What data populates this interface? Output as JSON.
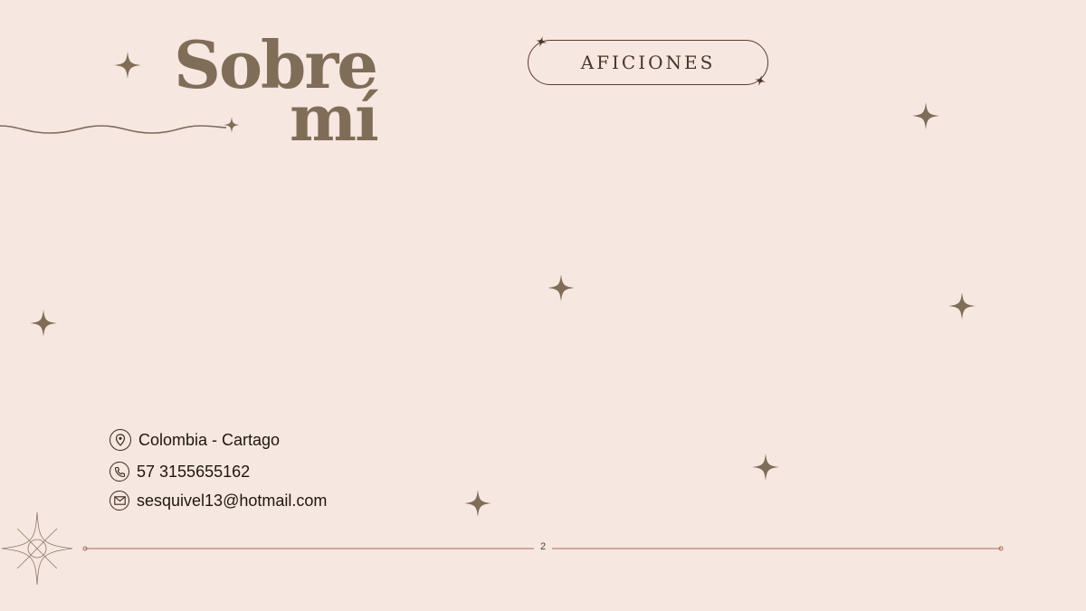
{
  "title": {
    "line1": "Sobre",
    "line2": "mí"
  },
  "section_pill": {
    "label": "AFICIONES"
  },
  "contacts": [
    {
      "icon": "location-pin-icon",
      "text": "Colombia - Cartago"
    },
    {
      "icon": "phone-icon",
      "text": "57 3155655162"
    },
    {
      "icon": "mail-icon",
      "text": "sesquivel13@hotmail.com"
    }
  ],
  "footer": {
    "page_number": "2"
  },
  "colors": {
    "background": "#f7e7e1",
    "accent": "#7f6d58",
    "line": "#a86a55",
    "text": "#1f1510"
  }
}
